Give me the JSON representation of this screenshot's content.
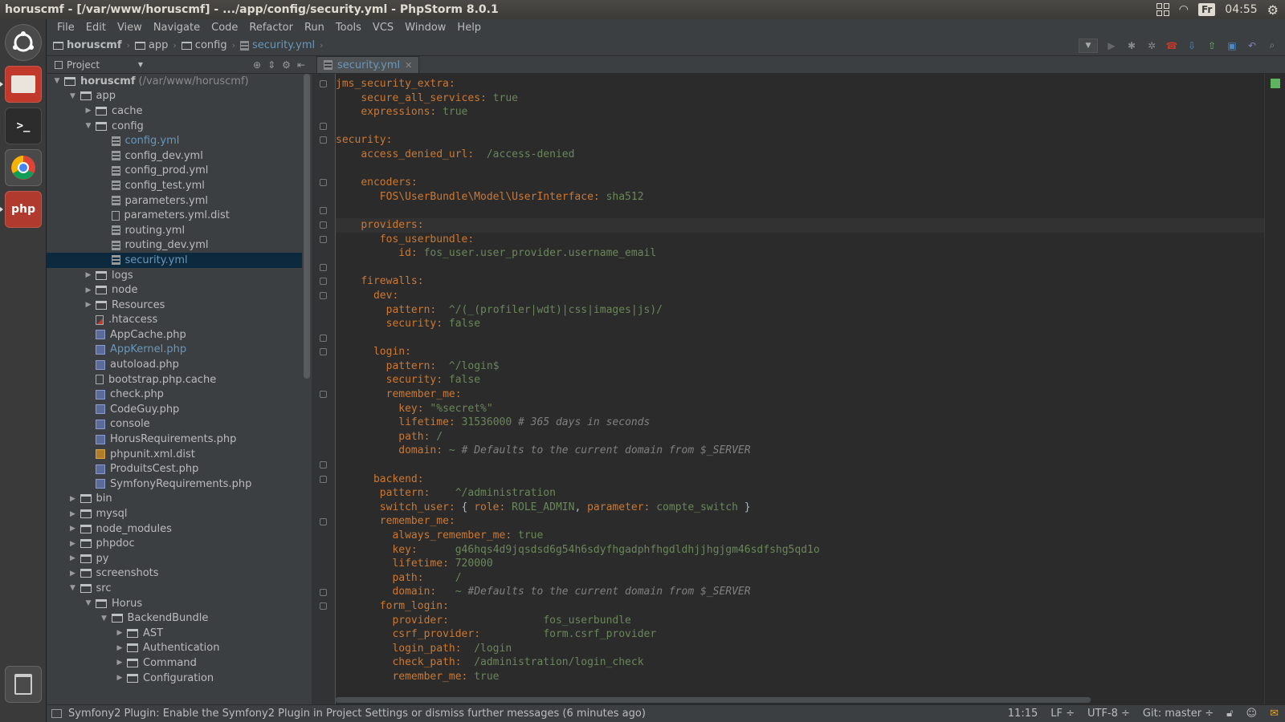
{
  "window": {
    "title": "horuscmf - [/var/www/horuscmf] - .../app/config/security.yml - PhpStorm 8.0.1"
  },
  "panel": {
    "keyboard": "Fr",
    "clock": "04:55"
  },
  "menu": [
    "File",
    "Edit",
    "View",
    "Navigate",
    "Code",
    "Refactor",
    "Run",
    "Tools",
    "VCS",
    "Window",
    "Help"
  ],
  "breadcrumbs": [
    "horuscmf",
    "app",
    "config",
    "security.yml"
  ],
  "project": {
    "title": "Project"
  },
  "tree": [
    {
      "label": "horuscmf",
      "hint": "(/var/www/horuscmf)",
      "depth": 0,
      "type": "folder",
      "expanded": true,
      "bold": true
    },
    {
      "label": "app",
      "depth": 1,
      "type": "folder",
      "expanded": true
    },
    {
      "label": "cache",
      "depth": 2,
      "type": "folder",
      "expanded": false
    },
    {
      "label": "config",
      "depth": 2,
      "type": "folder",
      "expanded": true
    },
    {
      "label": "config.yml",
      "depth": 3,
      "type": "yml",
      "blue": true
    },
    {
      "label": "config_dev.yml",
      "depth": 3,
      "type": "yml"
    },
    {
      "label": "config_prod.yml",
      "depth": 3,
      "type": "yml"
    },
    {
      "label": "config_test.yml",
      "depth": 3,
      "type": "yml"
    },
    {
      "label": "parameters.yml",
      "depth": 3,
      "type": "yml"
    },
    {
      "label": "parameters.yml.dist",
      "depth": 3,
      "type": "file"
    },
    {
      "label": "routing.yml",
      "depth": 3,
      "type": "yml"
    },
    {
      "label": "routing_dev.yml",
      "depth": 3,
      "type": "yml"
    },
    {
      "label": "security.yml",
      "depth": 3,
      "type": "yml",
      "blue": true,
      "selected": true
    },
    {
      "label": "logs",
      "depth": 2,
      "type": "folder",
      "expanded": false
    },
    {
      "label": "node",
      "depth": 2,
      "type": "folder",
      "expanded": false
    },
    {
      "label": "Resources",
      "depth": 2,
      "type": "folder",
      "expanded": false
    },
    {
      "label": ".htaccess",
      "depth": 2,
      "type": "ht"
    },
    {
      "label": "AppCache.php",
      "depth": 2,
      "type": "php"
    },
    {
      "label": "AppKernel.php",
      "depth": 2,
      "type": "php",
      "blue": true
    },
    {
      "label": "autoload.php",
      "depth": 2,
      "type": "php"
    },
    {
      "label": "bootstrap.php.cache",
      "depth": 2,
      "type": "file"
    },
    {
      "label": "check.php",
      "depth": 2,
      "type": "php"
    },
    {
      "label": "CodeGuy.php",
      "depth": 2,
      "type": "php"
    },
    {
      "label": "console",
      "depth": 2,
      "type": "php"
    },
    {
      "label": "HorusRequirements.php",
      "depth": 2,
      "type": "php"
    },
    {
      "label": "phpunit.xml.dist",
      "depth": 2,
      "type": "xml"
    },
    {
      "label": "ProduitsCest.php",
      "depth": 2,
      "type": "php"
    },
    {
      "label": "SymfonyRequirements.php",
      "depth": 2,
      "type": "php"
    },
    {
      "label": "bin",
      "depth": 1,
      "type": "folder",
      "expanded": false
    },
    {
      "label": "mysql",
      "depth": 1,
      "type": "folder",
      "expanded": false
    },
    {
      "label": "node_modules",
      "depth": 1,
      "type": "folder",
      "expanded": false
    },
    {
      "label": "phpdoc",
      "depth": 1,
      "type": "folder",
      "expanded": false
    },
    {
      "label": "py",
      "depth": 1,
      "type": "folder",
      "expanded": false
    },
    {
      "label": "screenshots",
      "depth": 1,
      "type": "folder",
      "expanded": false
    },
    {
      "label": "src",
      "depth": 1,
      "type": "folder",
      "expanded": true
    },
    {
      "label": "Horus",
      "depth": 2,
      "type": "folder",
      "expanded": true
    },
    {
      "label": "BackendBundle",
      "depth": 3,
      "type": "folder",
      "expanded": true
    },
    {
      "label": "AST",
      "depth": 4,
      "type": "folder",
      "expanded": false
    },
    {
      "label": "Authentication",
      "depth": 4,
      "type": "folder",
      "expanded": false
    },
    {
      "label": "Command",
      "depth": 4,
      "type": "folder",
      "expanded": false
    },
    {
      "label": "Configuration",
      "depth": 4,
      "type": "folder",
      "expanded": false
    }
  ],
  "editor": {
    "tab": "security.yml",
    "lines": [
      {
        "fold": true,
        "parts": [
          [
            "k",
            "jms_security_extra:"
          ]
        ]
      },
      {
        "parts": [
          [
            "t",
            "    "
          ],
          [
            "k",
            "secure_all_services:"
          ],
          [
            "t",
            " "
          ],
          [
            "v",
            "true"
          ]
        ]
      },
      {
        "parts": [
          [
            "t",
            "    "
          ],
          [
            "k",
            "expressions:"
          ],
          [
            "t",
            " "
          ],
          [
            "v",
            "true"
          ]
        ]
      },
      {
        "fold": true,
        "parts": []
      },
      {
        "fold": true,
        "parts": [
          [
            "k",
            "security:"
          ]
        ]
      },
      {
        "parts": [
          [
            "t",
            "    "
          ],
          [
            "k",
            "access_denied_url:"
          ],
          [
            "t",
            "  "
          ],
          [
            "v",
            "/access-denied"
          ]
        ]
      },
      {
        "parts": []
      },
      {
        "fold": true,
        "parts": [
          [
            "t",
            "    "
          ],
          [
            "k",
            "encoders:"
          ]
        ]
      },
      {
        "parts": [
          [
            "t",
            "       "
          ],
          [
            "k",
            "FOS\\UserBundle\\Model\\UserInterface:"
          ],
          [
            "t",
            " "
          ],
          [
            "v",
            "sha512"
          ]
        ]
      },
      {
        "fold": true,
        "parts": []
      },
      {
        "fold": true,
        "current": true,
        "parts": [
          [
            "t",
            "    "
          ],
          [
            "k",
            "providers:"
          ]
        ]
      },
      {
        "fold": true,
        "parts": [
          [
            "t",
            "       "
          ],
          [
            "k",
            "fos_userbundle:"
          ]
        ]
      },
      {
        "parts": [
          [
            "t",
            "          "
          ],
          [
            "k",
            "id:"
          ],
          [
            "t",
            " "
          ],
          [
            "v",
            "fos_user.user_provider.username_email"
          ]
        ]
      },
      {
        "fold": true,
        "parts": []
      },
      {
        "fold": true,
        "parts": [
          [
            "t",
            "    "
          ],
          [
            "k",
            "firewalls:"
          ]
        ]
      },
      {
        "fold": true,
        "parts": [
          [
            "t",
            "      "
          ],
          [
            "k",
            "dev:"
          ]
        ]
      },
      {
        "parts": [
          [
            "t",
            "        "
          ],
          [
            "k",
            "pattern:"
          ],
          [
            "t",
            "  "
          ],
          [
            "v",
            "^/(_(profiler|wdt)|css|images|js)/"
          ]
        ]
      },
      {
        "parts": [
          [
            "t",
            "        "
          ],
          [
            "k",
            "security:"
          ],
          [
            "t",
            " "
          ],
          [
            "v",
            "false"
          ]
        ]
      },
      {
        "fold": true,
        "parts": []
      },
      {
        "fold": true,
        "parts": [
          [
            "t",
            "      "
          ],
          [
            "k",
            "login:"
          ]
        ]
      },
      {
        "parts": [
          [
            "t",
            "        "
          ],
          [
            "k",
            "pattern:"
          ],
          [
            "t",
            "  "
          ],
          [
            "v",
            "^/login$"
          ]
        ]
      },
      {
        "parts": [
          [
            "t",
            "        "
          ],
          [
            "k",
            "security:"
          ],
          [
            "t",
            " "
          ],
          [
            "v",
            "false"
          ]
        ]
      },
      {
        "fold": true,
        "parts": [
          [
            "t",
            "        "
          ],
          [
            "k",
            "remember_me:"
          ]
        ]
      },
      {
        "parts": [
          [
            "t",
            "          "
          ],
          [
            "k",
            "key:"
          ],
          [
            "t",
            " "
          ],
          [
            "v",
            "\"%secret%\""
          ]
        ]
      },
      {
        "parts": [
          [
            "t",
            "          "
          ],
          [
            "k",
            "lifetime:"
          ],
          [
            "t",
            " "
          ],
          [
            "v",
            "31536000"
          ],
          [
            "t",
            " "
          ],
          [
            "c",
            "# 365 days in seconds"
          ]
        ]
      },
      {
        "parts": [
          [
            "t",
            "          "
          ],
          [
            "k",
            "path:"
          ],
          [
            "t",
            " "
          ],
          [
            "v",
            "/"
          ]
        ]
      },
      {
        "parts": [
          [
            "t",
            "          "
          ],
          [
            "k",
            "domain:"
          ],
          [
            "t",
            " "
          ],
          [
            "v",
            "~"
          ],
          [
            "t",
            " "
          ],
          [
            "c",
            "# Defaults to the current domain from $_SERVER"
          ]
        ]
      },
      {
        "fold": true,
        "parts": []
      },
      {
        "fold": true,
        "parts": [
          [
            "t",
            "      "
          ],
          [
            "k",
            "backend:"
          ]
        ]
      },
      {
        "parts": [
          [
            "t",
            "       "
          ],
          [
            "k",
            "pattern:"
          ],
          [
            "t",
            "    "
          ],
          [
            "v",
            "^/administration"
          ]
        ]
      },
      {
        "parts": [
          [
            "t",
            "       "
          ],
          [
            "k",
            "switch_user:"
          ],
          [
            "t",
            " { "
          ],
          [
            "k",
            "role:"
          ],
          [
            "t",
            " "
          ],
          [
            "v",
            "ROLE_ADMIN"
          ],
          [
            "t",
            ", "
          ],
          [
            "k",
            "parameter:"
          ],
          [
            "t",
            " "
          ],
          [
            "v",
            "compte_switch"
          ],
          [
            "t",
            " }"
          ]
        ]
      },
      {
        "fold": true,
        "parts": [
          [
            "t",
            "       "
          ],
          [
            "k",
            "remember_me:"
          ]
        ]
      },
      {
        "parts": [
          [
            "t",
            "         "
          ],
          [
            "k",
            "always_remember_me:"
          ],
          [
            "t",
            " "
          ],
          [
            "v",
            "true"
          ]
        ]
      },
      {
        "parts": [
          [
            "t",
            "         "
          ],
          [
            "k",
            "key:"
          ],
          [
            "t",
            "      "
          ],
          [
            "v",
            "g46hqs4d9jqsdsd6g54h6sdyfhgadphfhgdldhjjhgjgm46sdfshg5qd1o"
          ]
        ]
      },
      {
        "parts": [
          [
            "t",
            "         "
          ],
          [
            "k",
            "lifetime:"
          ],
          [
            "t",
            " "
          ],
          [
            "v",
            "720000"
          ]
        ]
      },
      {
        "parts": [
          [
            "t",
            "         "
          ],
          [
            "k",
            "path:"
          ],
          [
            "t",
            "     "
          ],
          [
            "v",
            "/"
          ]
        ]
      },
      {
        "fold": true,
        "parts": [
          [
            "t",
            "         "
          ],
          [
            "k",
            "domain:"
          ],
          [
            "t",
            "   "
          ],
          [
            "v",
            "~"
          ],
          [
            "t",
            " "
          ],
          [
            "c",
            "#Defaults to the current domain from $_SERVER"
          ]
        ]
      },
      {
        "fold": true,
        "parts": [
          [
            "t",
            "       "
          ],
          [
            "k",
            "form_login:"
          ]
        ]
      },
      {
        "parts": [
          [
            "t",
            "         "
          ],
          [
            "k",
            "provider:"
          ],
          [
            "t",
            "               "
          ],
          [
            "v",
            "fos_userbundle"
          ]
        ]
      },
      {
        "parts": [
          [
            "t",
            "         "
          ],
          [
            "k",
            "csrf_provider:"
          ],
          [
            "t",
            "          "
          ],
          [
            "v",
            "form.csrf_provider"
          ]
        ]
      },
      {
        "parts": [
          [
            "t",
            "         "
          ],
          [
            "k",
            "login_path:"
          ],
          [
            "t",
            "  "
          ],
          [
            "v",
            "/login"
          ]
        ]
      },
      {
        "parts": [
          [
            "t",
            "         "
          ],
          [
            "k",
            "check_path:"
          ],
          [
            "t",
            "  "
          ],
          [
            "v",
            "/administration/login_check"
          ]
        ]
      },
      {
        "parts": [
          [
            "t",
            "         "
          ],
          [
            "k",
            "remember_me:"
          ],
          [
            "t",
            " "
          ],
          [
            "v",
            "true"
          ]
        ]
      }
    ]
  },
  "status": {
    "message": "Symfony2 Plugin: Enable the Symfony2 Plugin in Project Settings or dismiss further messages (6 minutes ago)",
    "position": "11:15",
    "line_sep": "LF ÷",
    "encoding": "UTF-8 ÷",
    "vcs": "Git: master ÷"
  },
  "colors": {
    "keyword": "#cc7832",
    "value": "#6a8759",
    "comment": "#808080",
    "selection": "#0d293e"
  }
}
